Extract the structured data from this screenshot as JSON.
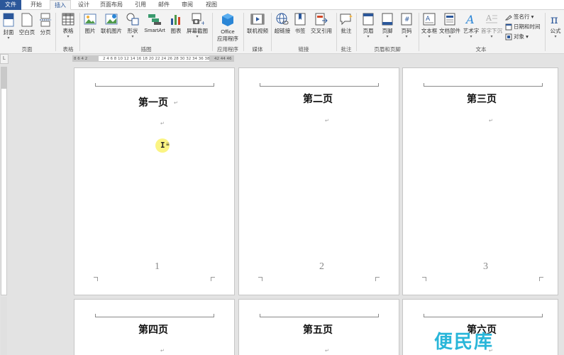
{
  "tabs": [
    {
      "label": "文件",
      "kind": "file"
    },
    {
      "label": "开始"
    },
    {
      "label": "插入",
      "active": true
    },
    {
      "label": "设计"
    },
    {
      "label": "页面布局"
    },
    {
      "label": "引用"
    },
    {
      "label": "邮件"
    },
    {
      "label": "审阅"
    },
    {
      "label": "视图"
    }
  ],
  "ribbon": {
    "pages_group": {
      "label": "页面",
      "cover": "封面",
      "blank": "空白页",
      "break": "分页"
    },
    "table_group": {
      "label": "表格",
      "table": "表格"
    },
    "illustrations_group": {
      "label": "插图",
      "picture": "图片",
      "online_picture": "联机图片",
      "shapes": "形状",
      "smartart": "SmartArt",
      "chart": "图表",
      "screenshot": "屏幕截图"
    },
    "apps_group": {
      "label": "应用程序",
      "office": "Office",
      "office_line2": "应用程序"
    },
    "media_group": {
      "label": "媒体",
      "online_video": "联机视频"
    },
    "links_group": {
      "label": "链接",
      "hyperlink": "超链接",
      "bookmark": "书签",
      "cross_ref": "交叉引用"
    },
    "comments_group": {
      "label": "批注",
      "comment": "批注"
    },
    "header_footer_group": {
      "label": "页眉和页脚",
      "header": "页眉",
      "footer": "页脚",
      "page_number": "页码"
    },
    "text_group": {
      "label": "文本",
      "textbox": "文本框",
      "quick_parts": "文档部件",
      "wordart": "艺术字",
      "dropcap": "首字下沉",
      "signature": "签名行",
      "datetime": "日期和时间",
      "object": "对象"
    },
    "symbols_group": {
      "formula": "公式"
    }
  },
  "ruler": {
    "corner": "L",
    "ticks_left": "8  6  4  2",
    "ticks_main": "2  4  6  8  10 12 14 16 18 20 22 24 26 28 30 32 34 36 38",
    "ticks_right": "42 44 46"
  },
  "pages": [
    {
      "title": "第一页",
      "number": "1"
    },
    {
      "title": "第二页",
      "number": "2"
    },
    {
      "title": "第三页",
      "number": "3"
    },
    {
      "title": "第四页",
      "number": ""
    },
    {
      "title": "第五页",
      "number": ""
    },
    {
      "title": "第六页",
      "number": ""
    }
  ],
  "paragraph_mark": "↵",
  "cursor": {
    "ibeam": "I",
    "mark": "≡"
  },
  "watermark": "便民库",
  "colors": {
    "file_tab": "#2b579a",
    "ribbon": "#f3f3f3",
    "workspace": "#e3e3e3",
    "watermark": "#29b6d9",
    "cursor_highlight": "#faf05a"
  }
}
